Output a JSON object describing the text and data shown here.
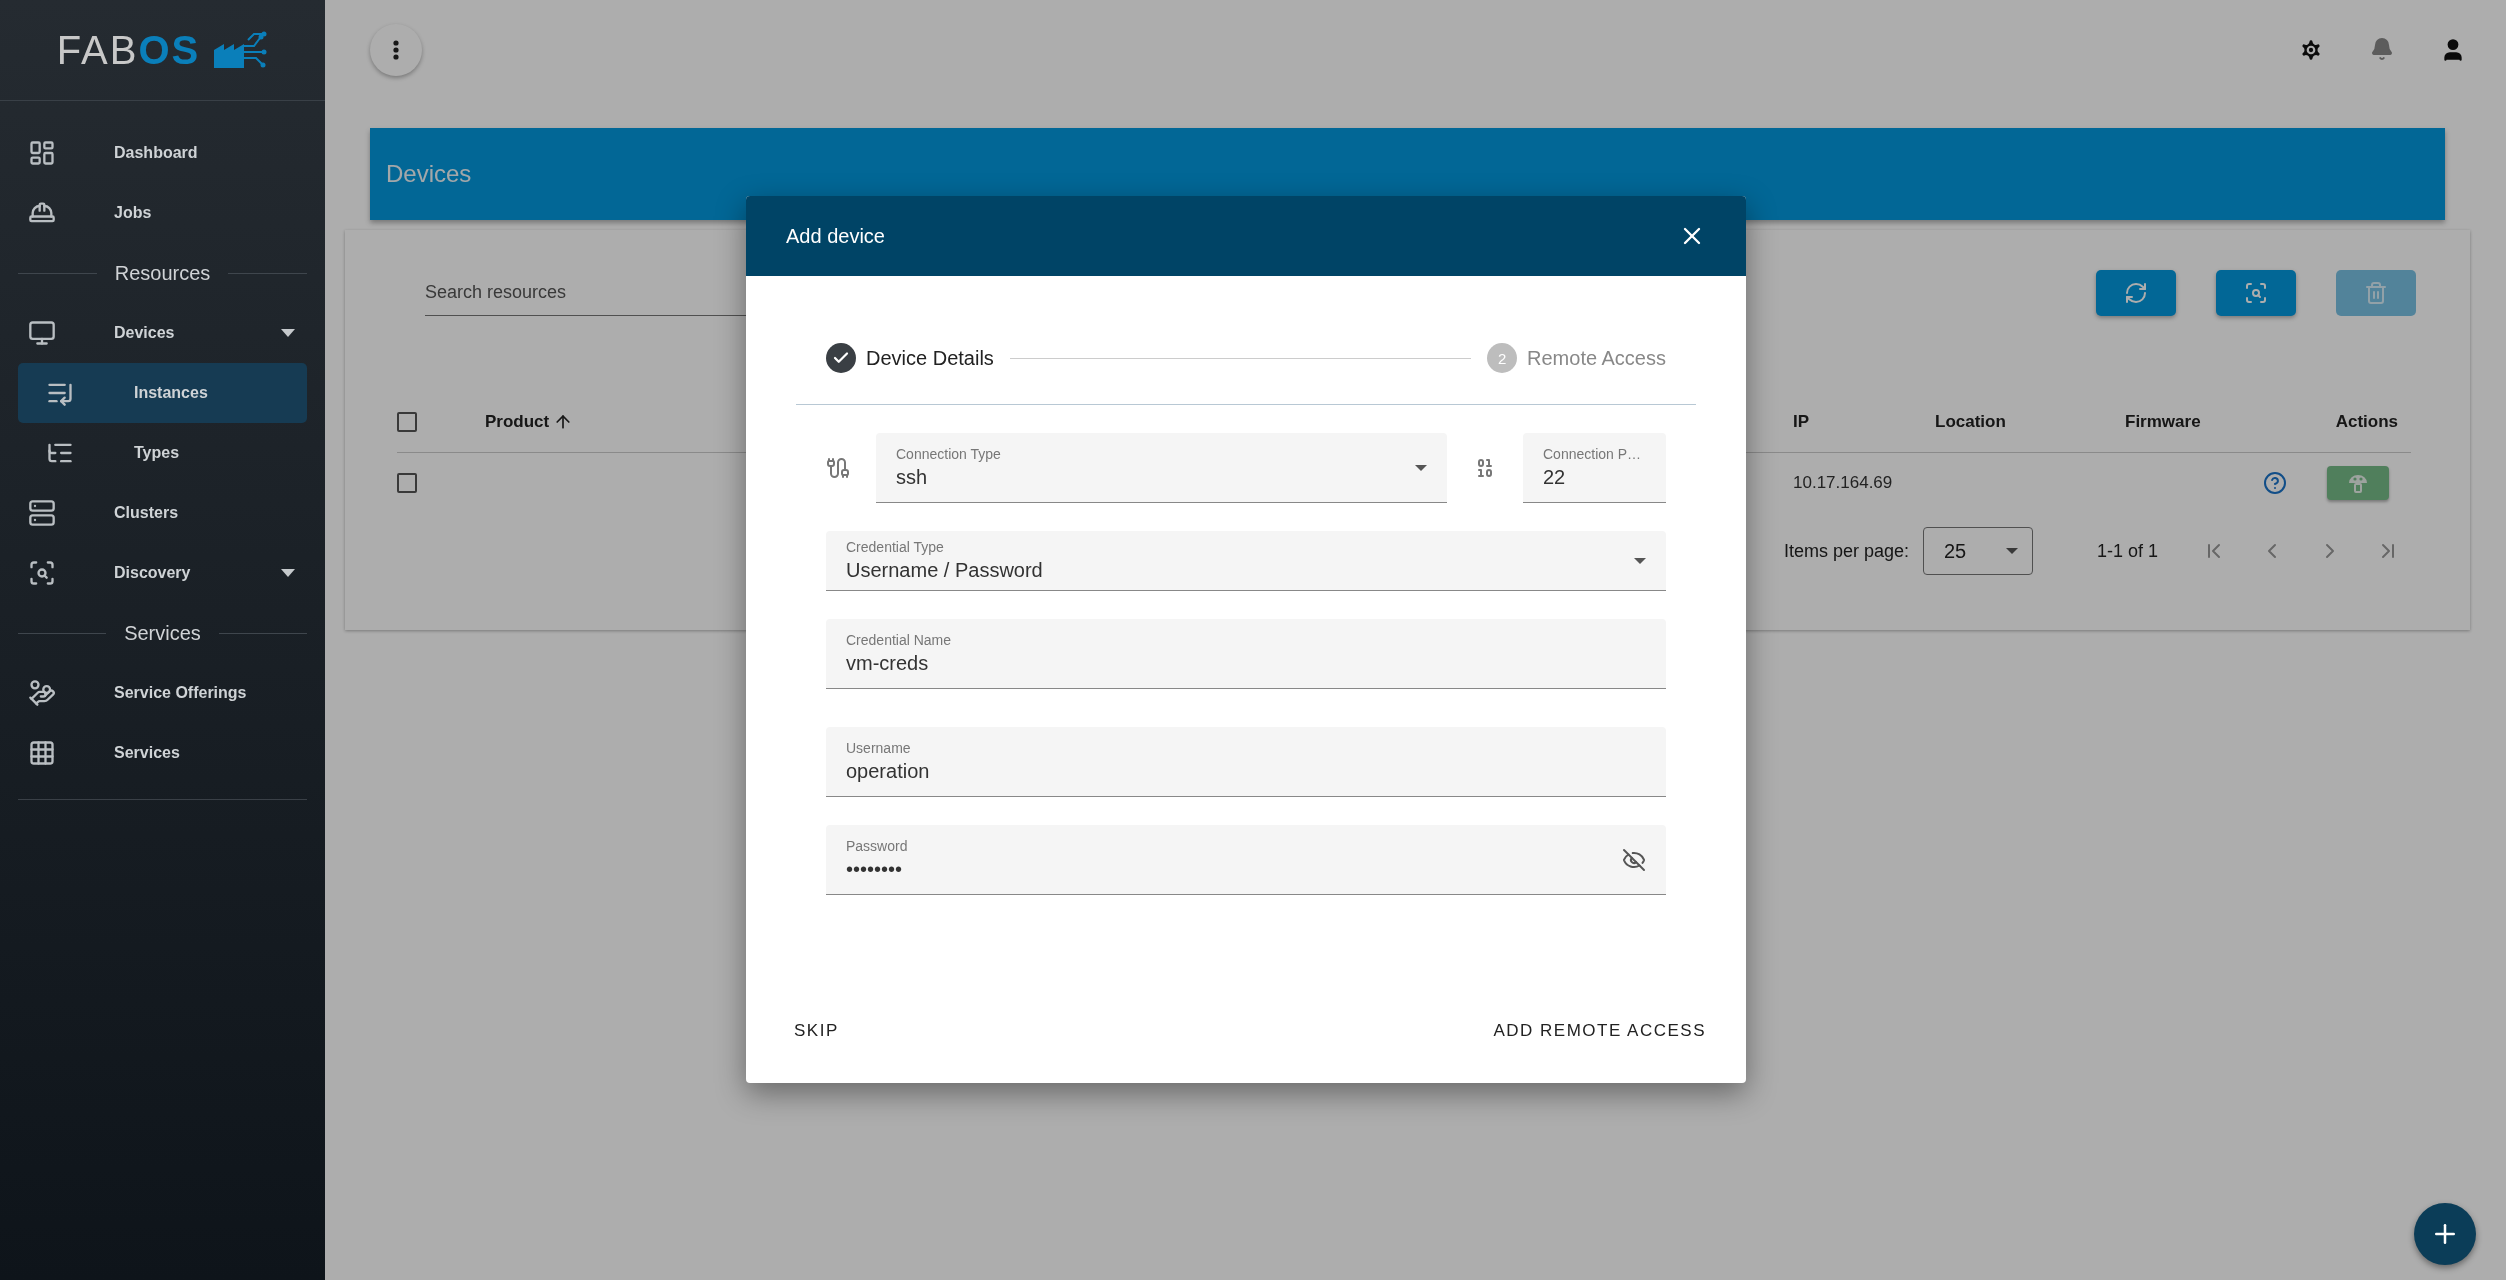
{
  "sidebar": {
    "logo": {
      "part_1": "FAB",
      "part_2": "OS"
    },
    "items": [
      {
        "kind": "item",
        "label": "Dashboard",
        "selected": false
      },
      {
        "kind": "item",
        "label": "Jobs",
        "selected": false
      },
      {
        "kind": "section",
        "label": "Resources"
      },
      {
        "kind": "item",
        "label": "Devices",
        "selected": false,
        "has_menu": true,
        "children": [
          {
            "kind": "item",
            "label": "Instances",
            "selected": true
          },
          {
            "kind": "item",
            "label": "Types",
            "selected": false
          }
        ]
      },
      {
        "kind": "item",
        "label": "Clusters",
        "selected": false
      },
      {
        "kind": "item",
        "label": "Discovery",
        "selected": false,
        "has_menu": true
      },
      {
        "kind": "section",
        "label": "Services"
      },
      {
        "kind": "item",
        "label": "Service Offerings",
        "selected": false
      },
      {
        "kind": "item",
        "label": "Services",
        "selected": false
      }
    ]
  },
  "page": {
    "title": "Devices",
    "search": {
      "placeholder": "Search resources"
    },
    "toolbar": [
      {
        "disabled": false
      },
      {
        "disabled": false
      },
      {
        "disabled": true
      }
    ],
    "table": {
      "select_all": {
        "checked": false
      },
      "columns": [
        {
          "label": "Product",
          "sorted": true
        },
        {
          "label": "IP",
          "sorted": false
        },
        {
          "label": "Location",
          "sorted": false
        },
        {
          "label": "Firmware",
          "sorted": false
        },
        {
          "label": "Actions",
          "sorted": false
        }
      ],
      "rows": [
        {
          "checked": false,
          "ip": "10.17.164.69"
        }
      ]
    },
    "pager": {
      "label": "Items per page:",
      "page_size": "25",
      "range": "1-1 of 1"
    }
  },
  "dialog": {
    "title": "Add device",
    "steps": [
      {
        "label": "Device Details",
        "completed": true
      },
      {
        "label": "Remote Access",
        "completed": false,
        "number": "2"
      }
    ],
    "rows": [
      {
        "fields": [
          {
            "kind": "select",
            "label": "Connection Type",
            "value": "ssh"
          },
          {
            "kind": "input",
            "label": "Connection P…",
            "value": "22"
          }
        ]
      },
      {
        "fields": [
          {
            "kind": "select",
            "label": "Credential Type",
            "value": "Username / Password"
          }
        ]
      },
      {
        "fields": [
          {
            "kind": "input",
            "label": "Credential Name",
            "value": "vm-creds"
          }
        ]
      },
      {
        "fields": [
          {
            "kind": "input",
            "label": "Username",
            "value": "operation"
          }
        ]
      },
      {
        "fields": [
          {
            "kind": "password",
            "label": "Password",
            "value": "••••••••"
          }
        ]
      }
    ],
    "actions": [
      "SKIP",
      "ADD REMOTE ACCESS"
    ]
  }
}
